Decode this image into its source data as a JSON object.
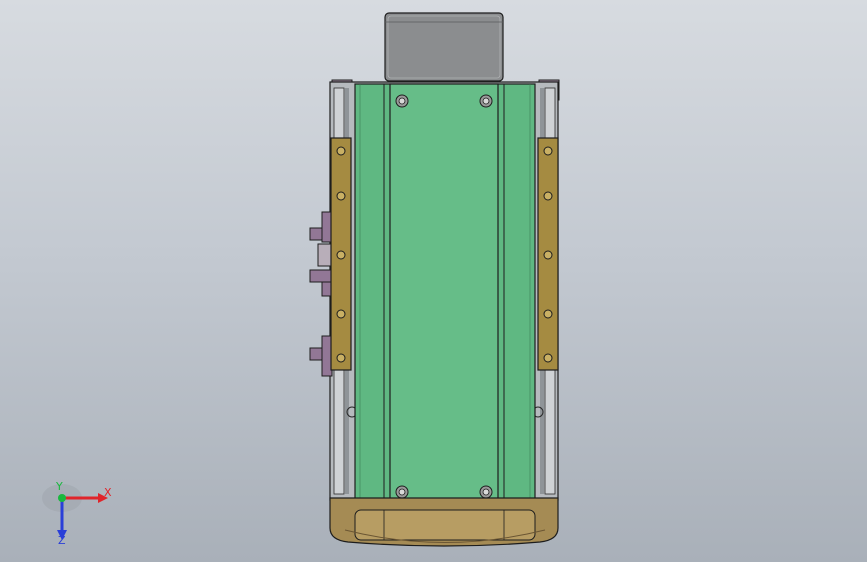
{
  "viewport": {
    "background_top": "#d7dbe0",
    "background_bottom": "#a9b0b9"
  },
  "model": {
    "motor_color": "#8a8a8a",
    "rail_color": "#a9adb1",
    "belt_color": "#5fb882",
    "belt_stripe_color": "#6dc290",
    "slide_bar_color": "#a58b41",
    "end_cap_color": "#a58b54",
    "bracket_color": "#8e7590",
    "outline_color": "#1d1d1d"
  },
  "triad": {
    "x_label": "X",
    "y_label": "Y",
    "z_label": "Z",
    "x_color": "#e0242a",
    "y_color": "#19b83e",
    "z_color": "#2a3fd8"
  }
}
